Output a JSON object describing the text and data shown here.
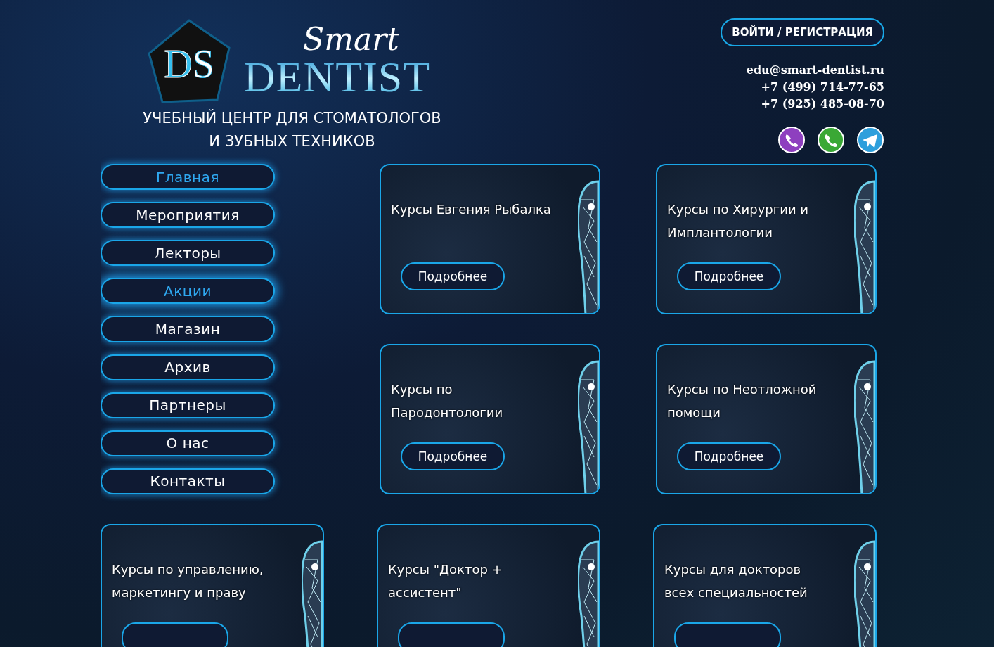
{
  "logo": {
    "monogram": [
      "D",
      "S"
    ],
    "script": "Smart",
    "wordmark": "DENTIST"
  },
  "tagline": [
    "УЧЕБНЫЙ ЦЕНТР ДЛЯ СТОМАТОЛОГОВ",
    "И ЗУБНЫХ ТЕХНИКОВ"
  ],
  "login_button": "ВОЙТИ / РЕГИСТРАЦИЯ",
  "contacts": [
    "edu@smart-dentist.ru",
    "+7 (499) 714-77-65",
    "+7 (925) 485-08-70"
  ],
  "messengers": [
    {
      "kind": "viber",
      "color": "#8e3fbf"
    },
    {
      "kind": "whatsapp",
      "color": "#3aa835"
    },
    {
      "kind": "telegram",
      "color": "#2d9fdc"
    }
  ],
  "nav": [
    {
      "label": "Главная",
      "active": true,
      "hovered": false
    },
    {
      "label": "Мероприятия",
      "active": false,
      "hovered": false
    },
    {
      "label": "Лекторы",
      "active": false,
      "hovered": false
    },
    {
      "label": "Акции",
      "active": false,
      "hovered": true
    },
    {
      "label": "Магазин",
      "active": false,
      "hovered": false
    },
    {
      "label": "Архив",
      "active": false,
      "hovered": false
    },
    {
      "label": "Партнеры",
      "active": false,
      "hovered": false
    },
    {
      "label": "О нас",
      "active": false,
      "hovered": false
    },
    {
      "label": "Контакты",
      "active": false,
      "hovered": false
    }
  ],
  "courses": [
    {
      "title": "Курсы Евгения Рыбалка",
      "button": "Подробнее"
    },
    {
      "title": "Курсы по Хирургии и Имплантологии",
      "button": "Подробнее"
    },
    {
      "title": "Курсы по Пародонтологии",
      "button": "Подробнее"
    },
    {
      "title": "Курсы по Неотложной помощи",
      "button": "Подробнее"
    },
    {
      "title": "Курсы по управлению, маркетингу и праву"
    },
    {
      "title": "Курсы \"Доктор + ассистент\""
    },
    {
      "title": "Курсы для докторов всех специальностей"
    }
  ]
}
